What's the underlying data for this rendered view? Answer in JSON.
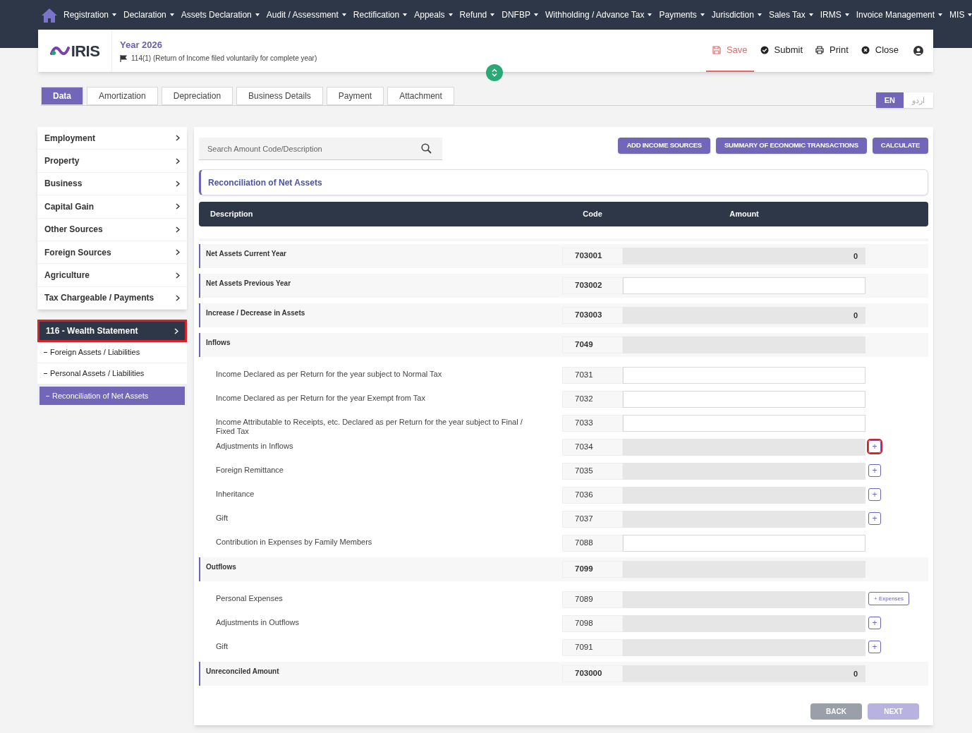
{
  "nav": {
    "items": [
      {
        "label": "Registration"
      },
      {
        "label": "Declaration"
      },
      {
        "label": "Assets Declaration"
      },
      {
        "label": "Audit / Assessment"
      },
      {
        "label": "Rectification"
      },
      {
        "label": "Appeals"
      },
      {
        "label": "Refund"
      },
      {
        "label": "DNFBP"
      },
      {
        "label": "Withholding / Advance Tax"
      },
      {
        "label": "Payments"
      },
      {
        "label": "Jurisdiction"
      },
      {
        "label": "Sales Tax"
      },
      {
        "label": "IRMS"
      },
      {
        "label": "Invoice Management"
      },
      {
        "label": "MIS"
      }
    ]
  },
  "header": {
    "logo": "IRIS",
    "title": "Year 2026",
    "subtitle": "114(1) (Return of Income filed voluntarily for complete year)",
    "actions": [
      {
        "kind": "save",
        "label": "Save",
        "selected": true
      },
      {
        "kind": "submit",
        "label": "Submit",
        "selected": false
      },
      {
        "kind": "print",
        "label": "Print",
        "selected": false
      },
      {
        "kind": "close",
        "label": "Close",
        "selected": false
      }
    ]
  },
  "tabs": [
    {
      "label": "Data",
      "selected": true
    },
    {
      "label": "Amortization",
      "selected": false
    },
    {
      "label": "Depreciation",
      "selected": false
    },
    {
      "label": "Business Details",
      "selected": false
    },
    {
      "label": "Payment",
      "selected": false
    },
    {
      "label": "Attachment",
      "selected": false
    }
  ],
  "languages": [
    {
      "label": "EN",
      "selected": true
    },
    {
      "label": "اردو",
      "selected": false
    }
  ],
  "sidebar": {
    "items": [
      {
        "label": "Employment"
      },
      {
        "label": "Property"
      },
      {
        "label": "Business"
      },
      {
        "label": "Capital Gain"
      },
      {
        "label": "Other Sources"
      },
      {
        "label": "Foreign Sources"
      },
      {
        "label": "Agriculture"
      },
      {
        "label": "Tax Chargeable / Payments"
      }
    ],
    "section": {
      "label": "116 - Wealth Statement",
      "highlighted": true,
      "children": [
        {
          "label": "Foreign Assets / Liabilities",
          "selected": false,
          "highlighted": false
        },
        {
          "label": "Personal Assets / Liabilities",
          "selected": false,
          "highlighted": false
        },
        {
          "label": "Reconciliation of Net Assets",
          "selected": true,
          "highlighted": true
        }
      ]
    }
  },
  "search": {
    "placeholder": "Search Amount Code/Description"
  },
  "buttons": [
    "ADD INCOME SOURCES",
    "SUMMARY OF ECONOMIC TRANSACTIONS",
    "CALCULATE"
  ],
  "form_title": "Reconciliation of Net Assets",
  "table": {
    "columns": [
      "Description",
      "Code",
      "Amount"
    ],
    "rows": [
      {
        "kind": "section",
        "description": "Net Assets Current Year",
        "code": "703001",
        "amount": "0",
        "editable": false
      },
      {
        "kind": "section",
        "description": "Net Assets Previous Year",
        "code": "703002",
        "editable": true
      },
      {
        "kind": "section",
        "description": "Increase / Decrease in Assets",
        "code": "703003",
        "amount": "0",
        "editable": false
      },
      {
        "kind": "section",
        "description": "Inflows",
        "code": "7049",
        "editable": false
      },
      {
        "kind": "item",
        "description": "Income Declared as per Return for the year subject to Normal Tax",
        "code": "7031",
        "editable": true
      },
      {
        "kind": "item",
        "description": "Income Declared as per Return for the year Exempt from Tax",
        "code": "7032",
        "editable": true
      },
      {
        "kind": "item",
        "description": "Income Attributable to Receipts, etc. Declared as per Return for the year subject to Final / Fixed Tax",
        "code": "7033",
        "editable": true
      },
      {
        "kind": "item",
        "description": "Adjustments in Inflows",
        "code": "7034",
        "editable": false,
        "action": {
          "kind": "add",
          "label": "+",
          "highlighted": true
        }
      },
      {
        "kind": "item",
        "description": "Foreign Remittance",
        "code": "7035",
        "editable": false,
        "action": {
          "kind": "add",
          "label": "+",
          "highlighted": false
        }
      },
      {
        "kind": "item",
        "description": "Inheritance",
        "code": "7036",
        "editable": false,
        "action": {
          "kind": "add",
          "label": "+",
          "highlighted": false
        }
      },
      {
        "kind": "item",
        "description": "Gift",
        "code": "7037",
        "editable": false,
        "action": {
          "kind": "add",
          "label": "+",
          "highlighted": false
        }
      },
      {
        "kind": "item",
        "description": "Contribution in Expenses by Family Members",
        "code": "7088",
        "editable": true
      },
      {
        "kind": "section",
        "description": "Outflows",
        "code": "7099",
        "editable": false
      },
      {
        "kind": "item",
        "description": "Personal Expenses",
        "code": "7089",
        "editable": false,
        "action": {
          "kind": "text",
          "label": "+ Expenses",
          "highlighted": false
        }
      },
      {
        "kind": "item",
        "description": "Adjustments in Outflows",
        "code": "7098",
        "editable": false,
        "action": {
          "kind": "add",
          "label": "+",
          "highlighted": false
        }
      },
      {
        "kind": "item",
        "description": "Gift",
        "code": "7091",
        "editable": false,
        "action": {
          "kind": "add",
          "label": "+",
          "highlighted": false
        }
      },
      {
        "kind": "section",
        "description": "Unreconciled Amount",
        "code": "703000",
        "amount": "0",
        "editable": false
      }
    ]
  },
  "footer_buttons": [
    {
      "label": "BACK",
      "kind": "back"
    },
    {
      "label": "NEXT",
      "kind": "next"
    }
  ]
}
